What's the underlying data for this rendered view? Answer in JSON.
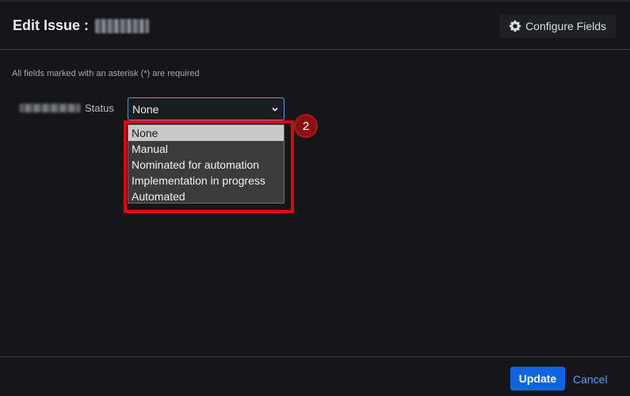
{
  "dialog": {
    "title": "Edit Issue :",
    "issue_key_redacted": true,
    "configure_fields_label": "Configure Fields"
  },
  "form": {
    "required_note": "All fields marked with an asterisk (*) are required",
    "status_field": {
      "label": "Status",
      "label_prefix_redacted": true,
      "selected_value": "None",
      "options": [
        "None",
        "Manual",
        "Nominated for automation",
        "Implementation in progress",
        "Automated"
      ]
    }
  },
  "annotation": {
    "step_number": "2",
    "highlight_color": "#e3000f"
  },
  "footer": {
    "update_label": "Update",
    "cancel_label": "Cancel"
  },
  "colors": {
    "background": "#161618",
    "primary": "#0c66e4",
    "link": "#579dff",
    "focus_border": "#4c9aff"
  },
  "icons": {
    "configure": "gear-icon",
    "select": "chevron-down-icon"
  }
}
